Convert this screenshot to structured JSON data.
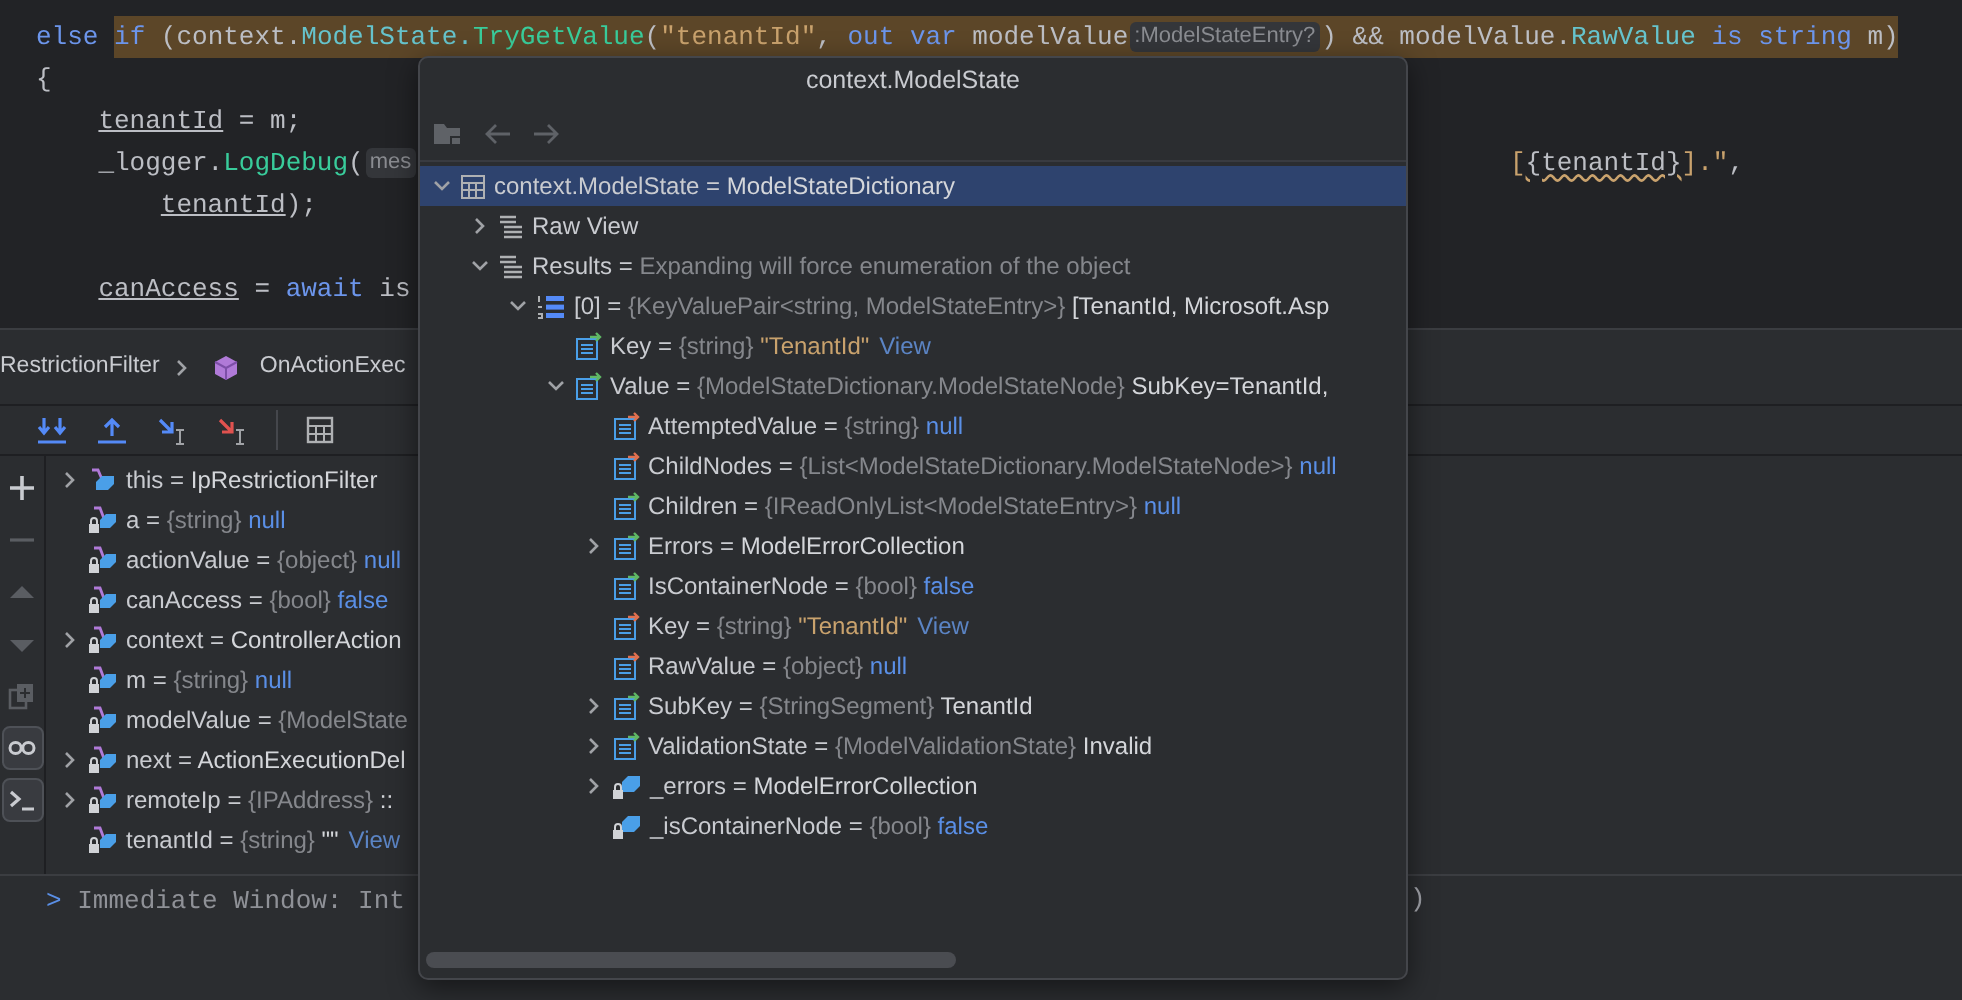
{
  "editor": {
    "lines": [
      {
        "kind": "code",
        "segments": [
          {
            "kind": "keyword",
            "text": "else "
          }
        ],
        "highlighted_segments": [
          {
            "kind": "keyword",
            "text": "if"
          },
          {
            "kind": "plain",
            "text": " (context."
          },
          {
            "kind": "member",
            "text": "ModelState."
          },
          {
            "kind": "method",
            "text": "TryGetValue"
          },
          {
            "kind": "plain",
            "text": "("
          },
          {
            "kind": "string",
            "text": "\"tenantId\""
          },
          {
            "kind": "plain",
            "text": ", "
          },
          {
            "kind": "keyword",
            "text": "out var"
          },
          {
            "kind": "plain",
            "text": " modelValue"
          },
          {
            "kind": "hint",
            "text": ":ModelStateEntry?"
          },
          {
            "kind": "plain",
            "text": ") && modelValue."
          },
          {
            "kind": "member",
            "text": "RawValue"
          },
          {
            "kind": "keyword",
            "text": " is string"
          },
          {
            "kind": "plain",
            "text": " m)"
          }
        ]
      },
      {
        "kind": "code",
        "segments": [
          {
            "kind": "plain",
            "text": "{"
          }
        ],
        "children": [
          {
            "kind": "code",
            "segments": [
              {
                "kind": "variable",
                "text": "tenantId"
              },
              {
                "kind": "plain",
                "text": " = m;"
              }
            ]
          },
          {
            "kind": "code",
            "segments": [
              {
                "kind": "plain",
                "text": "_logger."
              },
              {
                "kind": "method",
                "text": "LogDebug"
              },
              {
                "kind": "plain",
                "text": "("
              },
              {
                "kind": "hint",
                "text": "mes"
              }
            ],
            "right_segments": [
              {
                "kind": "string",
                "text": "["
              },
              {
                "kind": "squiggle",
                "text": "{tenantId}"
              },
              {
                "kind": "string",
                "text": "].\""
              },
              {
                "kind": "plain",
                "text": ","
              }
            ],
            "children": [
              {
                "kind": "code",
                "segments": [
                  {
                    "kind": "variable",
                    "text": "tenantId"
                  },
                  {
                    "kind": "plain",
                    "text": ");"
                  }
                ]
              }
            ]
          },
          {
            "kind": "blank"
          },
          {
            "kind": "code",
            "segments": [
              {
                "kind": "variable",
                "text": "canAccess"
              },
              {
                "kind": "plain",
                "text": " = "
              },
              {
                "kind": "keyword",
                "text": "await"
              },
              {
                "kind": "plain",
                "text": " is"
              }
            ]
          }
        ]
      }
    ]
  },
  "breadcrumb": [
    {
      "kind": "class",
      "text": "RestrictionFilter"
    },
    {
      "kind": "method",
      "text": "OnActionExec"
    }
  ],
  "debug_toolbar": [
    {
      "kind": "step-down"
    },
    {
      "kind": "step-up"
    },
    {
      "kind": "cursor-blue"
    },
    {
      "kind": "cursor-red"
    },
    {
      "kind": "table"
    }
  ],
  "side_toolbar": [
    {
      "kind": "plus",
      "disabled": false,
      "selected": false
    },
    {
      "kind": "minus",
      "disabled": true,
      "selected": false
    },
    {
      "kind": "up",
      "disabled": true,
      "selected": false
    },
    {
      "kind": "down",
      "disabled": true,
      "selected": false
    },
    {
      "kind": "copy",
      "disabled": true,
      "selected": false
    },
    {
      "kind": "glasses",
      "disabled": false,
      "selected": true
    },
    {
      "kind": "terminal",
      "disabled": false,
      "selected": true
    }
  ],
  "variables": [
    {
      "kind": "this",
      "label": "this =",
      "value": "IpRestrictionFilter",
      "expanded": false
    },
    {
      "kind": "local",
      "label": "a =",
      "type": "{string}",
      "literal": "null"
    },
    {
      "kind": "local",
      "label": "actionValue =",
      "type": "{object}",
      "literal": "null"
    },
    {
      "kind": "local",
      "label": "canAccess =",
      "type": "{bool}",
      "literal": "false"
    },
    {
      "kind": "local",
      "label": "context =",
      "value": "ControllerAction",
      "expanded": false
    },
    {
      "kind": "local",
      "label": "m =",
      "type": "{string}",
      "literal": "null"
    },
    {
      "kind": "local",
      "label": "modelValue =",
      "type": "{ModelState"
    },
    {
      "kind": "local",
      "label": "next =",
      "value": "ActionExecutionDel",
      "expanded": false
    },
    {
      "kind": "local",
      "label": "remoteIp =",
      "type": "{IPAddress}",
      "value": "::",
      "expanded": false
    },
    {
      "kind": "local",
      "label": "tenantId =",
      "type": "{string}",
      "value": "\"\"",
      "link": "View"
    }
  ],
  "immediate": {
    "prompt": ">",
    "text": "Immediate Window: Int",
    "tail": ")"
  },
  "popup": {
    "title": "context.ModelState",
    "toolbar": [
      {
        "kind": "folder",
        "disabled": true
      },
      {
        "kind": "back",
        "disabled": true
      },
      {
        "kind": "forward",
        "disabled": true
      }
    ],
    "tree": [
      {
        "kind": "dictionary",
        "label": "context.ModelState =",
        "value": "ModelStateDictionary",
        "expanded": true,
        "selected": true,
        "children": [
          {
            "kind": "view",
            "label": "Raw View",
            "expanded": false,
            "selected": false
          },
          {
            "kind": "view",
            "label": "Results =",
            "note": "Expanding will force enumeration of the object",
            "expanded": true,
            "selected": false,
            "children": [
              {
                "kind": "indexed",
                "label": "[0] =",
                "type": "{KeyValuePair<string, ModelStateEntry>}",
                "value": "[TenantId, Microsoft.Asp",
                "expanded": true,
                "selected": false,
                "children": [
                  {
                    "kind": "property-get",
                    "label": "Key =",
                    "type": "{string}",
                    "string": "\"TenantId\"",
                    "link": "View",
                    "selected": false
                  },
                  {
                    "kind": "property-get",
                    "label": "Value =",
                    "type": "{ModelStateDictionary.ModelStateNode}",
                    "value": "SubKey=TenantId,",
                    "expanded": true,
                    "selected": false,
                    "children": [
                      {
                        "kind": "property-set",
                        "label": "AttemptedValue =",
                        "type": "{string}",
                        "literal": "null",
                        "selected": false
                      },
                      {
                        "kind": "property-set",
                        "label": "ChildNodes =",
                        "type": "{List<ModelStateDictionary.ModelStateNode>}",
                        "literal": "null",
                        "selected": false
                      },
                      {
                        "kind": "property-get",
                        "label": "Children =",
                        "type": "{IReadOnlyList<ModelStateEntry>}",
                        "literal": "null",
                        "selected": false
                      },
                      {
                        "kind": "property-get",
                        "label": "Errors =",
                        "value": "ModelErrorCollection",
                        "expanded": false,
                        "selected": false
                      },
                      {
                        "kind": "property-get",
                        "label": "IsContainerNode =",
                        "type": "{bool}",
                        "literal": "false",
                        "selected": false
                      },
                      {
                        "kind": "property-set",
                        "label": "Key =",
                        "type": "{string}",
                        "string": "\"TenantId\"",
                        "link": "View",
                        "selected": false
                      },
                      {
                        "kind": "property-set",
                        "label": "RawValue =",
                        "type": "{object}",
                        "literal": "null",
                        "selected": false
                      },
                      {
                        "kind": "property-get",
                        "label": "SubKey =",
                        "type": "{StringSegment}",
                        "value": "TenantId",
                        "expanded": false,
                        "selected": false
                      },
                      {
                        "kind": "property-get",
                        "label": "ValidationState =",
                        "type": "{ModelValidationState}",
                        "value": "Invalid",
                        "expanded": false,
                        "selected": false
                      },
                      {
                        "kind": "private-field",
                        "label": "_errors =",
                        "value": "ModelErrorCollection",
                        "expanded": false,
                        "selected": false
                      },
                      {
                        "kind": "private-field",
                        "label": "_isContainerNode =",
                        "type": "{bool}",
                        "literal": "false",
                        "selected": false
                      }
                    ]
                  }
                ]
              }
            ]
          }
        ]
      }
    ]
  }
}
